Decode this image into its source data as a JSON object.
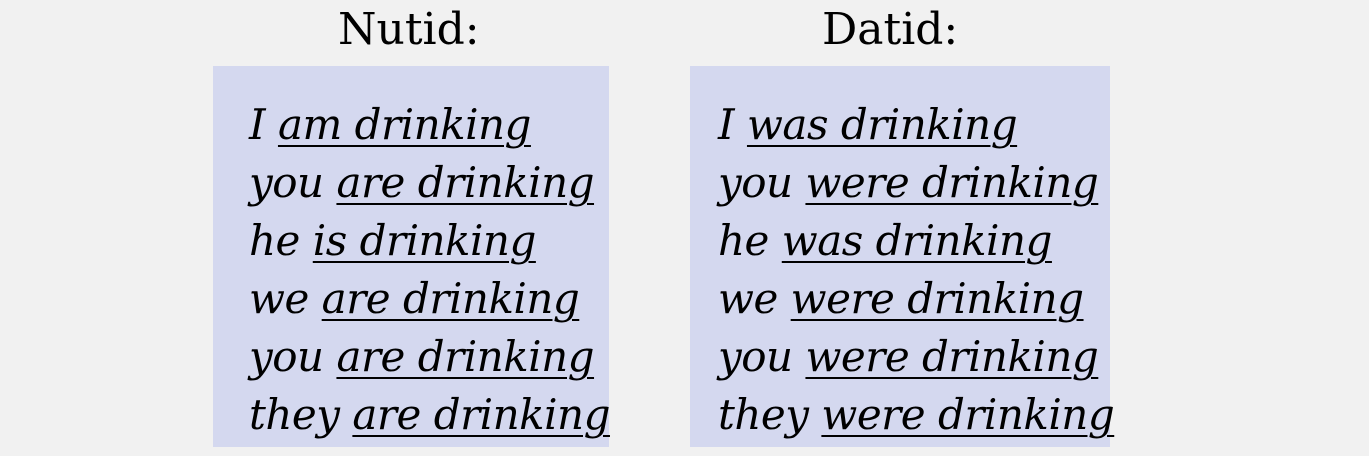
{
  "present": {
    "heading": "Nutid:",
    "rows": [
      {
        "pronoun": "I",
        "verb": "am drinking"
      },
      {
        "pronoun": "you",
        "verb": "are drinking"
      },
      {
        "pronoun": "he",
        "verb": "is drinking"
      },
      {
        "pronoun": "we",
        "verb": "are drinking"
      },
      {
        "pronoun": "you",
        "verb": "are drinking"
      },
      {
        "pronoun": "they",
        "verb": "are drinking"
      }
    ]
  },
  "past": {
    "heading": "Datid:",
    "rows": [
      {
        "pronoun": "I",
        "verb": "was drinking"
      },
      {
        "pronoun": "you",
        "verb": "were drinking"
      },
      {
        "pronoun": "he",
        "verb": "was drinking"
      },
      {
        "pronoun": "we",
        "verb": "were drinking"
      },
      {
        "pronoun": "you",
        "verb": "were drinking"
      },
      {
        "pronoun": "they",
        "verb": "were drinking"
      }
    ]
  },
  "colors": {
    "background": "#f1f1f1",
    "panel": "#d4d8ef",
    "text": "#000000"
  }
}
